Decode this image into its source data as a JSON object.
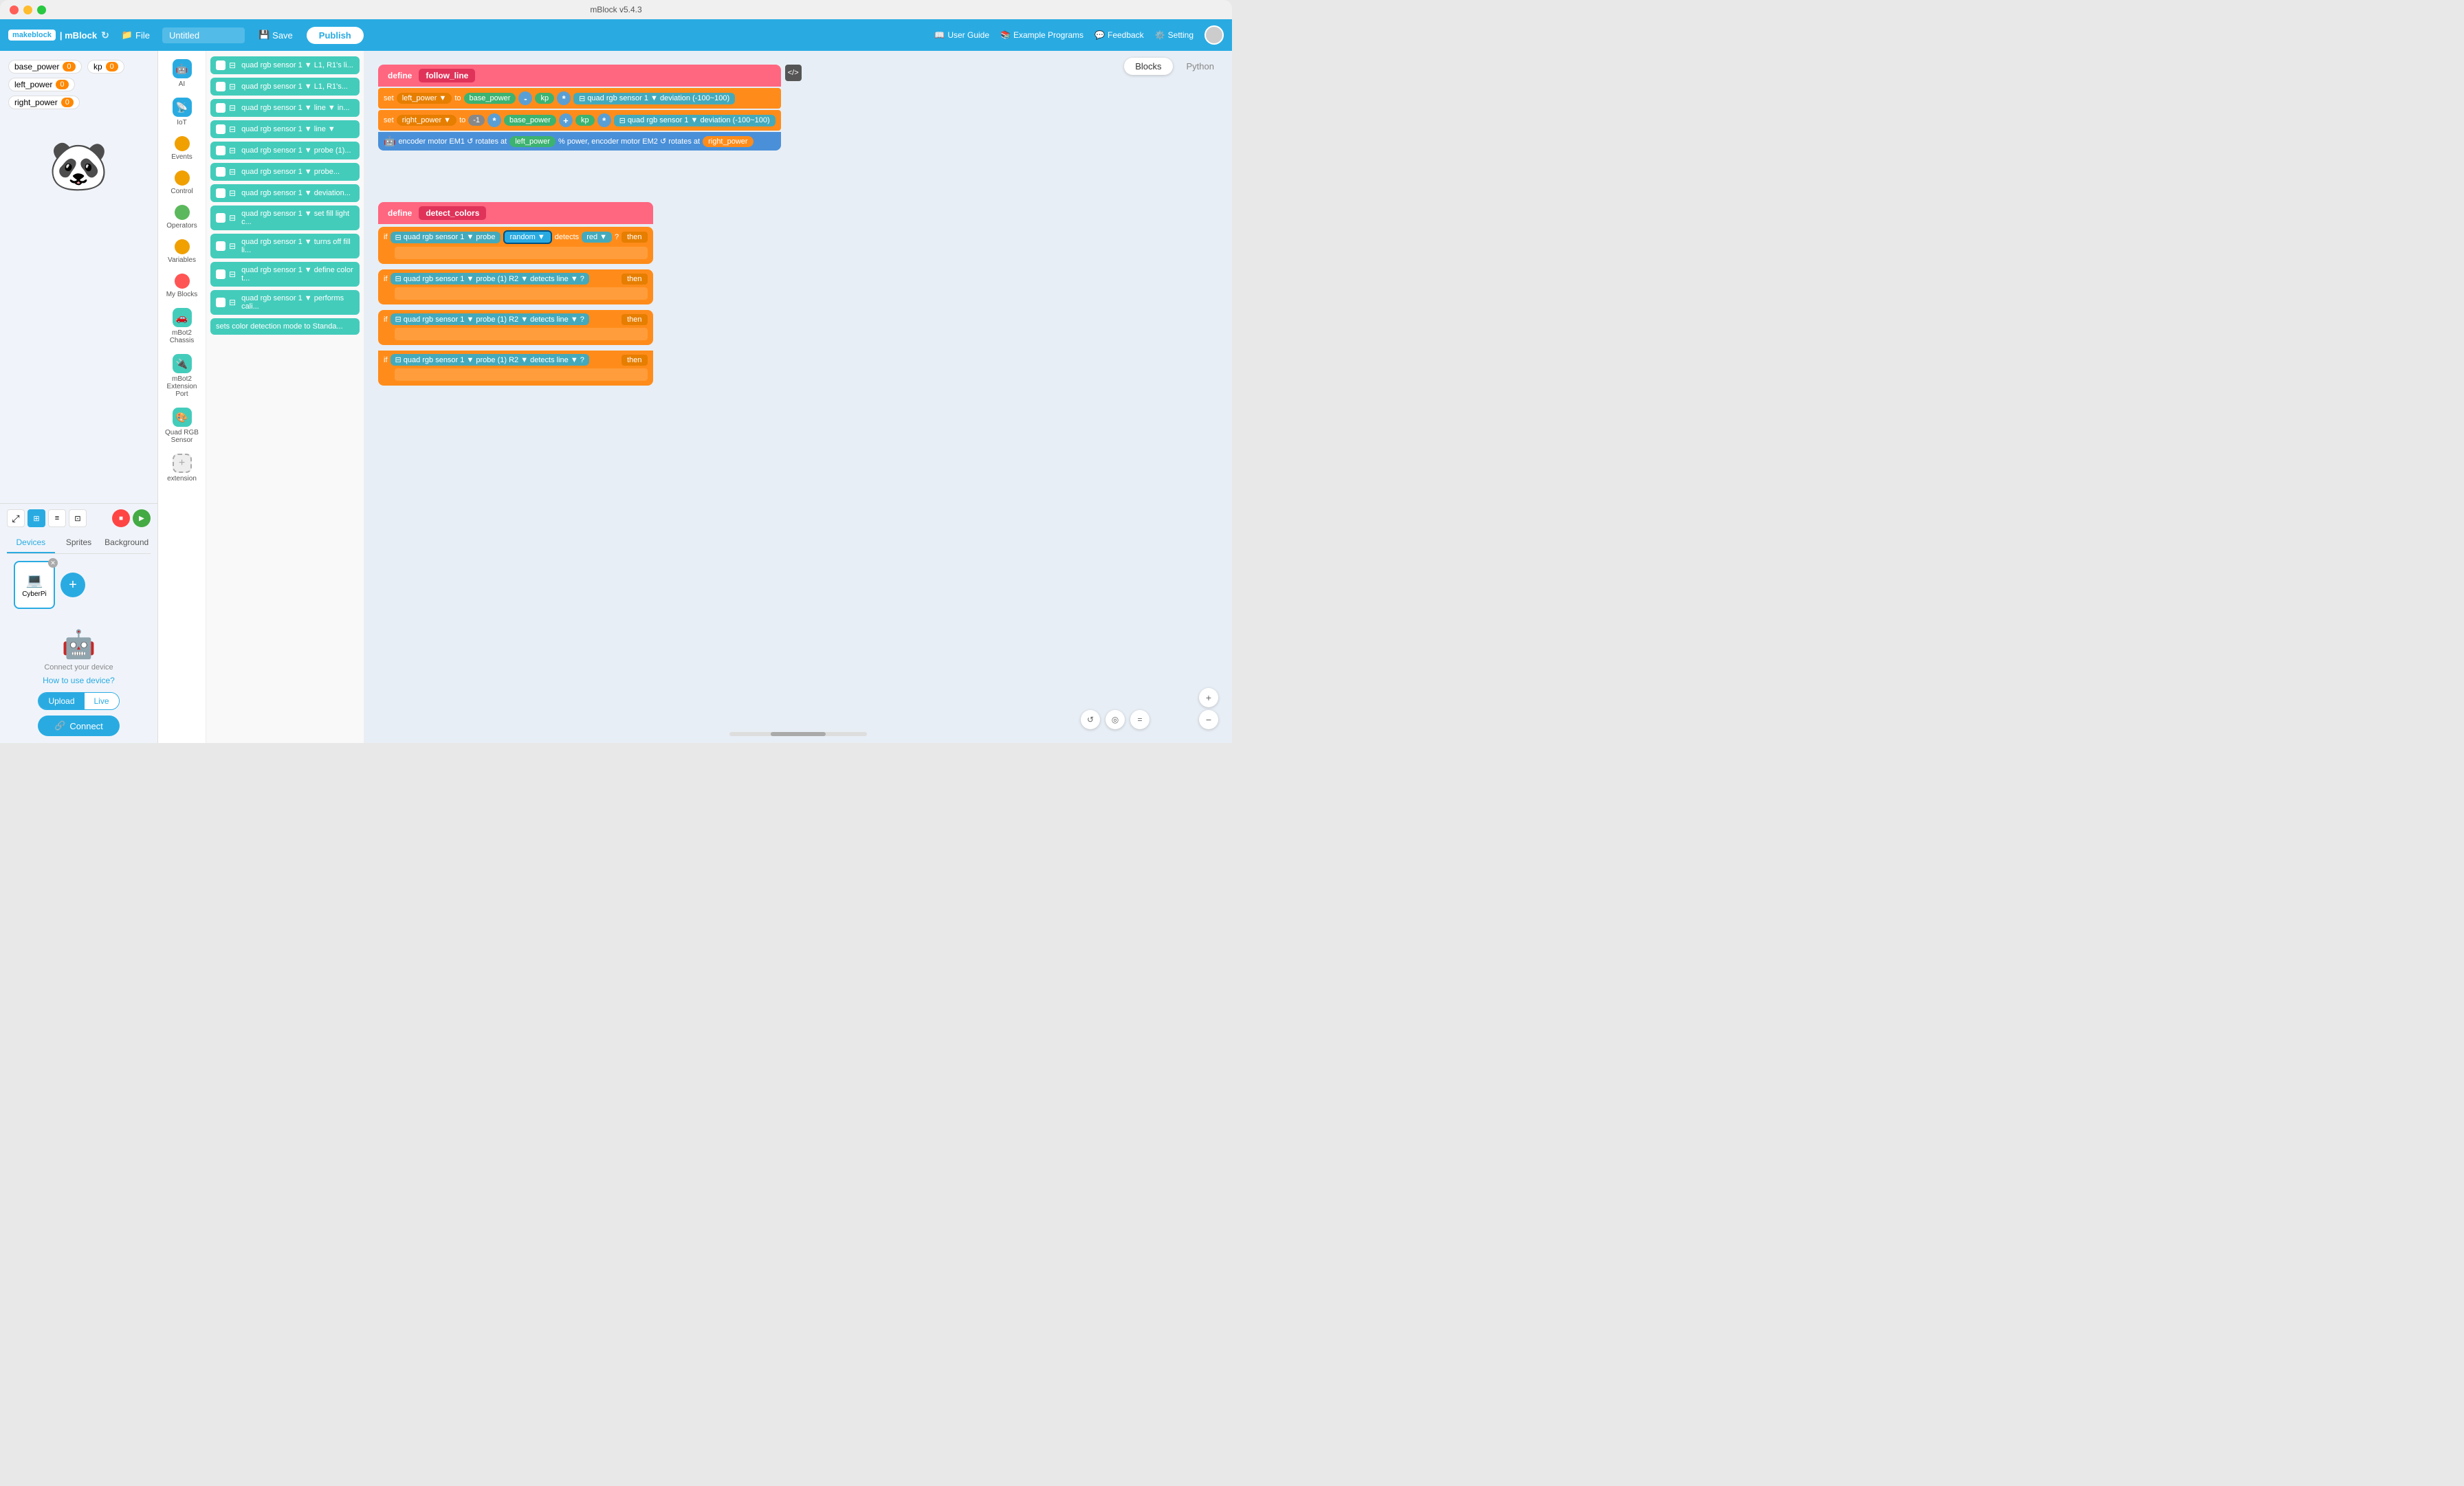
{
  "window": {
    "title": "mBlock v5.4.3",
    "traffic_lights": [
      "red",
      "yellow",
      "green"
    ]
  },
  "header": {
    "brand": "makeblock | mBlock",
    "file_label": "File",
    "title_value": "Untitled",
    "title_placeholder": "Untitled",
    "save_label": "Save",
    "publish_label": "Publish",
    "user_guide_label": "User Guide",
    "example_programs_label": "Example Programs",
    "feedback_label": "Feedback",
    "setting_label": "Setting"
  },
  "canvas_tabs": {
    "blocks_label": "Blocks",
    "python_label": "Python"
  },
  "variables": [
    {
      "name": "base_power",
      "value": "0"
    },
    {
      "name": "kp",
      "value": "0"
    },
    {
      "name": "left_power",
      "value": "0"
    },
    {
      "name": "right_power",
      "value": "0"
    }
  ],
  "left_tabs": {
    "devices_label": "Devices",
    "sprites_label": "Sprites",
    "background_label": "Background"
  },
  "devices": [
    {
      "name": "CyberPi",
      "icon": "💻"
    }
  ],
  "connect_area": {
    "subtitle": "Connect your device",
    "link": "How to use device?",
    "mode_switch": {
      "upload": "Upload",
      "live": "Live"
    },
    "connect_btn": "Connect"
  },
  "categories": [
    {
      "label": "AI",
      "color": "#29abe2",
      "icon": "🤖"
    },
    {
      "label": "IoT",
      "color": "#29abe2",
      "icon": "📡"
    },
    {
      "label": "Events",
      "color": "#f0a000",
      "icon": "●"
    },
    {
      "label": "Control",
      "color": "#f0a000",
      "icon": "●"
    },
    {
      "label": "Operators",
      "color": "#5cb85c",
      "icon": "●"
    },
    {
      "label": "Variables",
      "color": "#f0a000",
      "icon": "●"
    },
    {
      "label": "My Blocks",
      "color": "#f55",
      "icon": "🔧"
    },
    {
      "label": "mBot2 Chassis",
      "color": "#4cb",
      "icon": "🚗"
    },
    {
      "label": "mBot2 Extension Port",
      "color": "#4cb",
      "icon": "🔌"
    },
    {
      "label": "Quad RGB Sensor",
      "color": "#4cb",
      "icon": "🎨"
    },
    {
      "label": "extension",
      "color": "#4cb",
      "icon": "+"
    }
  ],
  "blocks": [
    "quad rgb sensor 1 ▼  L1, R1's li...",
    "quad rgb sensor 1 ▼  L1, R1's...",
    "quad rgb sensor 1 ▼  line ▼  in...",
    "quad rgb sensor 1 ▼  line ▼",
    "quad rgb sensor 1 ▼  probe (1)...",
    "quad rgb sensor 1 ▼  probe...",
    "quad rgb sensor 1 ▼  deviation...",
    "quad rgb sensor 1 ▼  set fill light c...",
    "quad rgb sensor 1 ▼  turns off fill li...",
    "quad rgb sensor 1 ▼  define color t...",
    "quad rgb sensor 1 ▼  performs cali...",
    "sets color detection mode to  Standa..."
  ],
  "code_sections": {
    "follow_line": {
      "define_label": "define",
      "fn_name": "follow_line",
      "set1": "set  left_power ▼  to  base_power  -  kp  *  quad rgb sensor  1 ▼  deviation (-100~100)",
      "set2": "set  right_power ▼  to  -1  *  base_power  +  kp  *  quad rgb sensor  1 ▼  deviation (-100~100)",
      "motor": "encoder motor EM1 ↺  rotates at  left_power  % power, encoder motor EM2 ↺  rotates at  right_power"
    },
    "detect_colors": {
      "define_label": "define",
      "fn_name": "detect_colors",
      "if1_cond": "quad rgb sensor  1 ▼  probe  random ▼  detects  red ▼  ?",
      "if1_then": "then",
      "if2_cond": "quad rgb sensor  1 ▼  probe  (1) R2 ▼  detects  line ▼  ?",
      "if2_then": "then",
      "if3_cond": "quad rgb sensor  1 ▼  probe  (1) R2 ▼  detects  line ▼  ?",
      "if3_then": "then",
      "if4_cond": "quad rgb sensor  1 ▼  probe  (1) R2 ▼  detects  line ▼  ?",
      "if4_then": "then"
    }
  }
}
